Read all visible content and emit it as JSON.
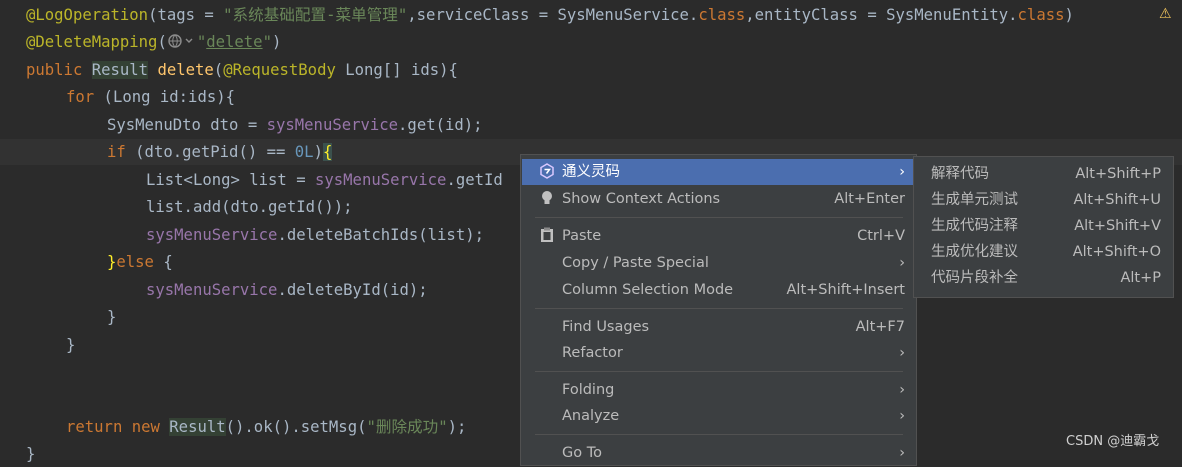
{
  "code": {
    "l1": {
      "anno": "@LogOperation",
      "a": "(tags = ",
      "tag": "\"系统基础配置-菜单管理\"",
      "b": ",serviceClass = SysMenuService.",
      "kw1": "class",
      "c": ",entityClass = SysMenuEntity.",
      "kw2": "class",
      "d": ")"
    },
    "l2": {
      "anno": "@DeleteMapping",
      "a": "(",
      "str1": "\"",
      "str2": "delete",
      "str3": "\"",
      "b": ")"
    },
    "l3": {
      "kw": "public ",
      "type": "Result",
      "sp": " ",
      "fn": "delete",
      "a": "(",
      "anno": "@RequestBody",
      "b": " Long[] ids){"
    },
    "l4": {
      "kw": "for",
      "a": " (Long id:ids){"
    },
    "l5": {
      "a": "SysMenuDto dto = ",
      "fld": "sysMenuService",
      "b": ".get(id);"
    },
    "l6": {
      "kw": "if",
      "a": " (dto.getPid() == ",
      "num": "0L",
      "b": ")",
      "brace": "{"
    },
    "l7": {
      "a": "List<Long> list = ",
      "fld": "sysMenuService",
      "b": ".getId"
    },
    "l8": {
      "a": "list.add(dto.getId());"
    },
    "l9": {
      "fld": "sysMenuService",
      "a": ".deleteBatchIds(list);"
    },
    "l10": {
      "brace": "}",
      "kw": "else",
      "a": " {"
    },
    "l11": {
      "fld": "sysMenuService",
      "a": ".deleteById(id);"
    },
    "l12": {
      "a": "}"
    },
    "l13": {
      "a": "}"
    },
    "l16": {
      "kw1": "return",
      "sp1": " ",
      "kw2": "new",
      "sp2": " ",
      "type": "Result",
      "a": "().ok().setMsg(",
      "str": "\"删除成功\"",
      "b": ");"
    },
    "l17": {
      "a": "}"
    }
  },
  "context_menu": {
    "items": [
      {
        "label": "通义灵码",
        "shortcut": "",
        "submenu": true,
        "icon": "tongyi-lingma-icon"
      },
      {
        "label": "Show Context Actions",
        "shortcut": "Alt+Enter",
        "icon": "lightbulb-icon"
      },
      {
        "label": "Paste",
        "shortcut": "Ctrl+V",
        "icon": "clipboard-icon"
      },
      {
        "label": "Copy / Paste Special",
        "shortcut": "",
        "submenu": true
      },
      {
        "label": "Column Selection Mode",
        "shortcut": "Alt+Shift+Insert"
      },
      {
        "label": "Find Usages",
        "shortcut": "Alt+F7"
      },
      {
        "label": "Refactor",
        "shortcut": "",
        "submenu": true
      },
      {
        "label": "Folding",
        "shortcut": "",
        "submenu": true
      },
      {
        "label": "Analyze",
        "shortcut": "",
        "submenu": true
      },
      {
        "label": "Go To",
        "shortcut": "",
        "submenu": true
      }
    ]
  },
  "submenu": {
    "items": [
      {
        "label": "解释代码",
        "shortcut": "Alt+Shift+P"
      },
      {
        "label": "生成单元测试",
        "shortcut": "Alt+Shift+U"
      },
      {
        "label": "生成代码注释",
        "shortcut": "Alt+Shift+V"
      },
      {
        "label": "生成优化建议",
        "shortcut": "Alt+Shift+O"
      },
      {
        "label": "代码片段补全",
        "shortcut": "Alt+P"
      }
    ]
  },
  "watermark": "CSDN @迪霸戈",
  "colors": {
    "editor_bg": "#2b2b2b",
    "menu_bg": "#3c3f41",
    "menu_selected": "#4b6eaf",
    "keyword": "#cc7832",
    "annotation": "#bbb529",
    "string": "#6a8759",
    "field": "#9876aa"
  }
}
